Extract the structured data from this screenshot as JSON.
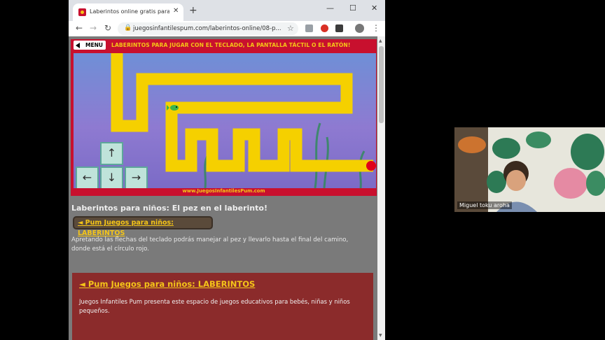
{
  "browser": {
    "tab_title": "Laberintos online gratis para niñ",
    "tab_close": "✕",
    "new_tab": "+",
    "controls": {
      "minimize": "—",
      "maximize": "☐",
      "close": "✕"
    },
    "nav": {
      "back": "←",
      "forward": "→",
      "reload": "↻"
    },
    "url": "juegosinfantilespum.com/laberintos-online/08-p...",
    "star": "☆",
    "menu": "⋮"
  },
  "game": {
    "menu_label": "MENU",
    "banner": "LABERINTOS PARA JUGAR CON EL TECLADO, LA PANTALLA TÁCTIL O EL RATÓN!",
    "footer_url": "www.JuegosInfantilesPum.com",
    "keys": {
      "up": "↑",
      "left": "←",
      "down": "↓",
      "right": "→"
    },
    "colors": {
      "path": "#f5d000",
      "goal": "#e0001a",
      "frame": "#c8102e"
    }
  },
  "page": {
    "heading": "Laberintos para niños: El pez en el laberinto!",
    "back_link": "◄ Pum Juegos para niños: LABERINTOS",
    "description": "Apretando las flechas del teclado podrás manejar al pez y llevarlo hasta el final del camino, donde está el círculo rojo.",
    "section_link": "◄ Pum Juegos para niños: LABERINTOS",
    "section_text": "Juegos Infantiles Pum presenta este espacio de juegos educativos para bebés, niñas y niños pequeños."
  },
  "video_call": {
    "participant_name": "Miguel toku aroha"
  }
}
